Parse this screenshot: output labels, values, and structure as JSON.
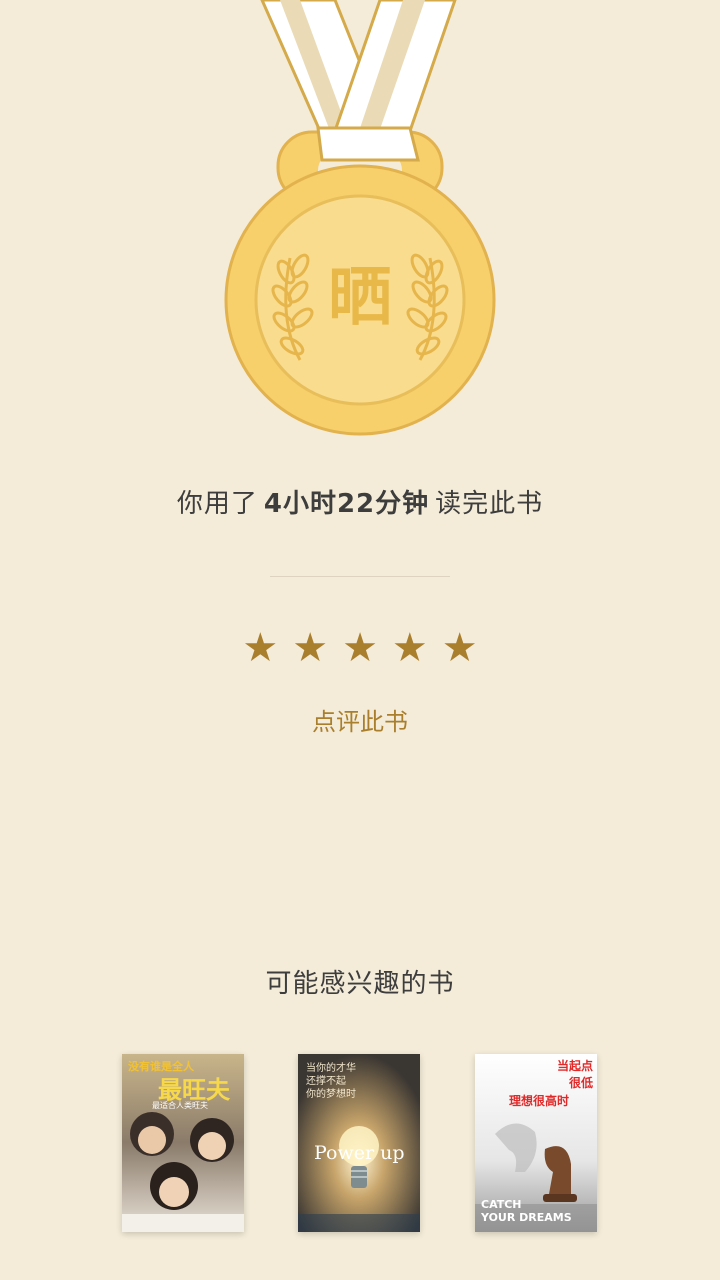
{
  "medal": {
    "character": "晒",
    "ribbon_color": "#ffffff",
    "ribbon_stripe_color": "#e9d9b3",
    "gold_color": "#f7cf6b",
    "gold_inner_color": "#f9dc8e"
  },
  "reading": {
    "prefix": "你用了",
    "duration": "4小时22分钟",
    "suffix": "读完此书"
  },
  "rating": {
    "stars": [
      "★",
      "★",
      "★",
      "★",
      "★"
    ],
    "value": 5,
    "max": 5,
    "color": "#a97f2e"
  },
  "review_button": {
    "label": "点评此书"
  },
  "recommendations": {
    "title": "可能感兴趣的书",
    "books": [
      {
        "top_line": "没有谁是全人",
        "title": "最旺夫",
        "subtitle": "最适合人类旺夫"
      },
      {
        "title_lines": [
          "当你的才华",
          "还撑不起",
          "你的梦想时"
        ],
        "title_en": "Power up"
      },
      {
        "title_lines": [
          "当起点",
          "很低",
          "理想很高时"
        ],
        "title_en_lines": [
          "CATCH",
          "YOUR DREAMS"
        ]
      }
    ]
  },
  "colors": {
    "background": "#f4ecd8",
    "accent": "#a97f2e",
    "text": "#3d3d3d",
    "divider": "#ddd3c0"
  }
}
